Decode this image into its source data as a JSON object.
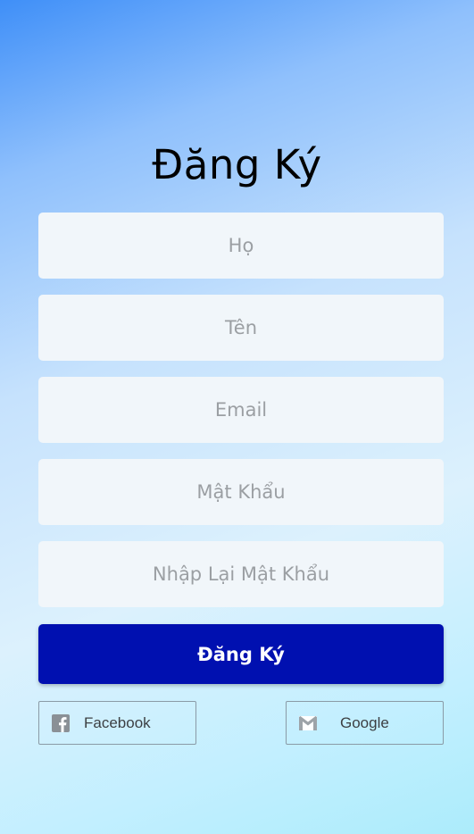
{
  "page": {
    "title": "Đăng Ký"
  },
  "form": {
    "fields": [
      {
        "name": "last-name",
        "placeholder": "Họ",
        "value": ""
      },
      {
        "name": "first-name",
        "placeholder": "Tên",
        "value": ""
      },
      {
        "name": "email",
        "placeholder": "Email",
        "value": ""
      },
      {
        "name": "password",
        "placeholder": "Mật Khẩu",
        "value": ""
      },
      {
        "name": "confirm-password",
        "placeholder": "Nhập Lại Mật Khẩu",
        "value": ""
      }
    ],
    "submit_label": "Đăng Ký"
  },
  "social": {
    "facebook": {
      "label": "Facebook",
      "icon": "facebook-icon"
    },
    "google": {
      "label": "Google",
      "icon": "gmail-icon"
    }
  },
  "colors": {
    "accent": "#0010b0",
    "field_bg": "#f1f6fa",
    "placeholder": "#9b9fa3"
  }
}
